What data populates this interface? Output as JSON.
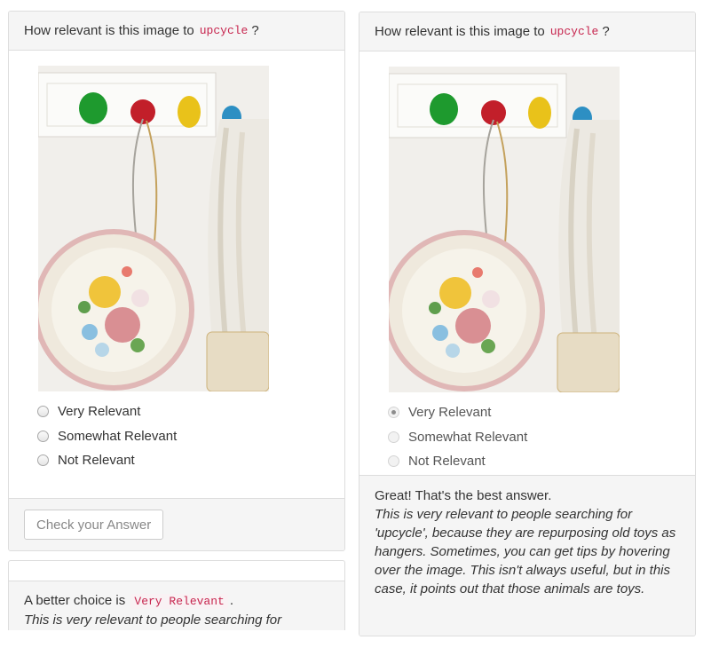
{
  "left": {
    "question_prefix": "How relevant is this image to",
    "keyword": "upcycle",
    "question_suffix": "?",
    "options": [
      "Very Relevant",
      "Somewhat Relevant",
      "Not Relevant"
    ],
    "check_button": "Check your Answer"
  },
  "left_feedback": {
    "prefix": "A better choice is",
    "answer": "Very Relevant",
    "suffix": ".",
    "explanation": "This is very relevant to people searching for"
  },
  "right": {
    "question_prefix": "How relevant is this image to",
    "keyword": "upcycle",
    "question_suffix": "?",
    "options": [
      "Very Relevant",
      "Somewhat Relevant",
      "Not Relevant"
    ],
    "selected_index": 0,
    "feedback_title": "Great! That's the best answer.",
    "feedback_text": "This is very relevant to people searching for 'upcycle', because they are repurposing old toys as hangers. Sometimes, you can get tips by hovering over the image. This isn't always useful, but in this case, it points out that those animals are toys."
  }
}
